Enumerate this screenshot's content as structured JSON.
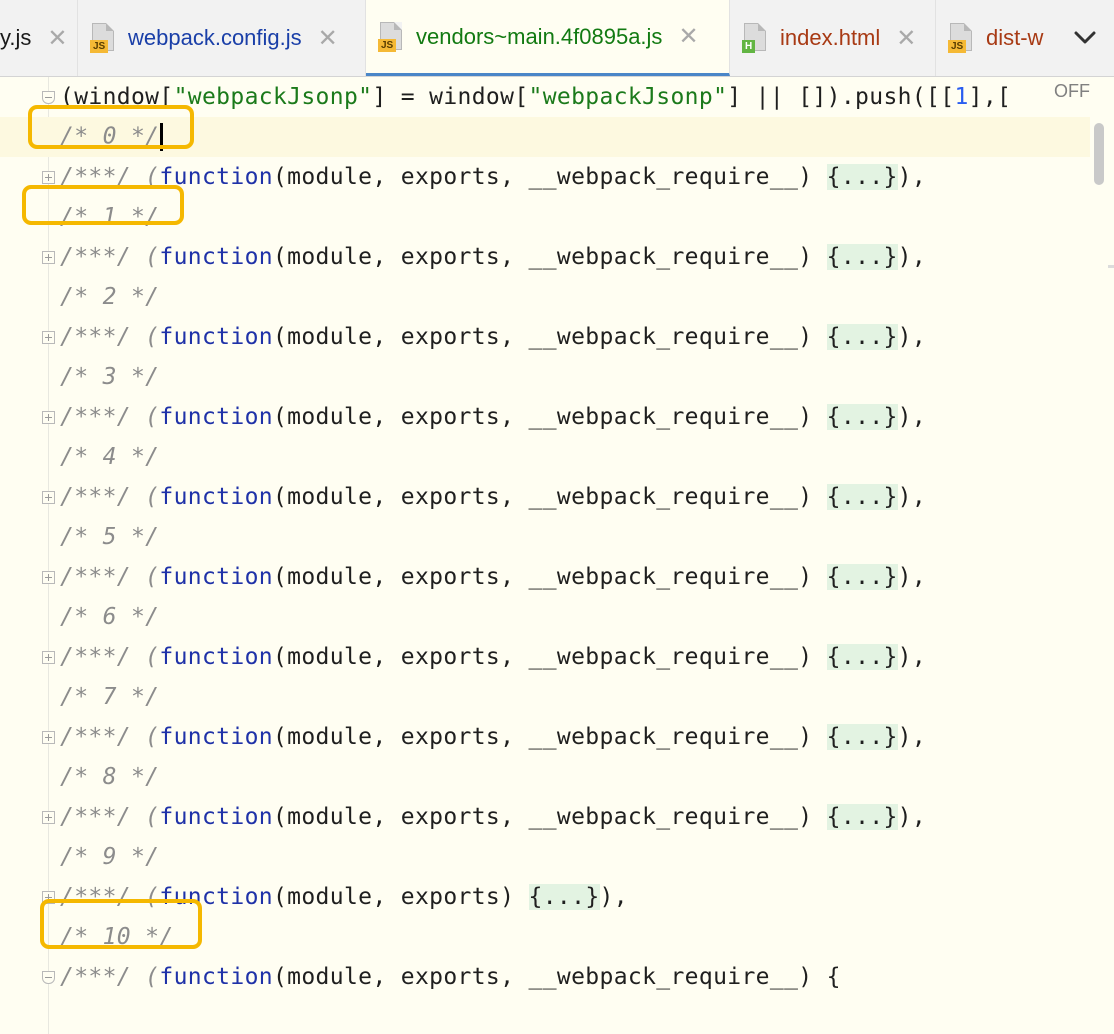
{
  "tabs": [
    {
      "label": "y.js",
      "color": "#1a1a1a",
      "icon": "js-file-icon",
      "badge": "",
      "closable": true,
      "active": false
    },
    {
      "label": "webpack.config.js",
      "color": "#1a3fa8",
      "icon": "js-file-icon",
      "badge": "JS",
      "closable": true,
      "active": false
    },
    {
      "label": "vendors~main.4f0895a.js",
      "color": "#127a12",
      "icon": "js-file-icon",
      "badge": "JS",
      "closable": true,
      "active": true
    },
    {
      "label": "index.html",
      "color": "#a83a14",
      "icon": "html-file-icon",
      "badge": "H",
      "closable": true,
      "active": false
    },
    {
      "label": "dist-w",
      "color": "#a83a14",
      "icon": "js-file-icon",
      "badge": "JS",
      "closable": false,
      "active": false
    }
  ],
  "close_glyph": "✕",
  "chevron_glyph": "❯",
  "editor_status": "OFF",
  "code": {
    "header_parts": [
      "(window[",
      "\"webpackJsonp\"",
      "] = window[",
      "\"webpackJsonp\"",
      "] || []).push([[",
      "1",
      "],["
    ],
    "module_prefix": "/***/ (",
    "function_keyword": "function",
    "module_args": "(module, exports, __webpack_require__) ",
    "module_args_short": "(module, exports) ",
    "folded_body": "{...}",
    "module_suffix": "),",
    "last_line_tail": "(module, exports, __webpack_require__) {",
    "comments": [
      "/* 0 */",
      "/* 1 */",
      "/* 2 */",
      "/* 3 */",
      "/* 4 */",
      "/* 5 */",
      "/* 6 */",
      "/* 7 */",
      "/* 8 */",
      "/* 9 */",
      "/* 10 */"
    ]
  },
  "colors": {
    "highlight_box": "#f5b800",
    "editor_background": "#fffef2",
    "keyword": "#1f32a8",
    "string": "#1b7a1b",
    "comment": "#8c8c8c"
  }
}
